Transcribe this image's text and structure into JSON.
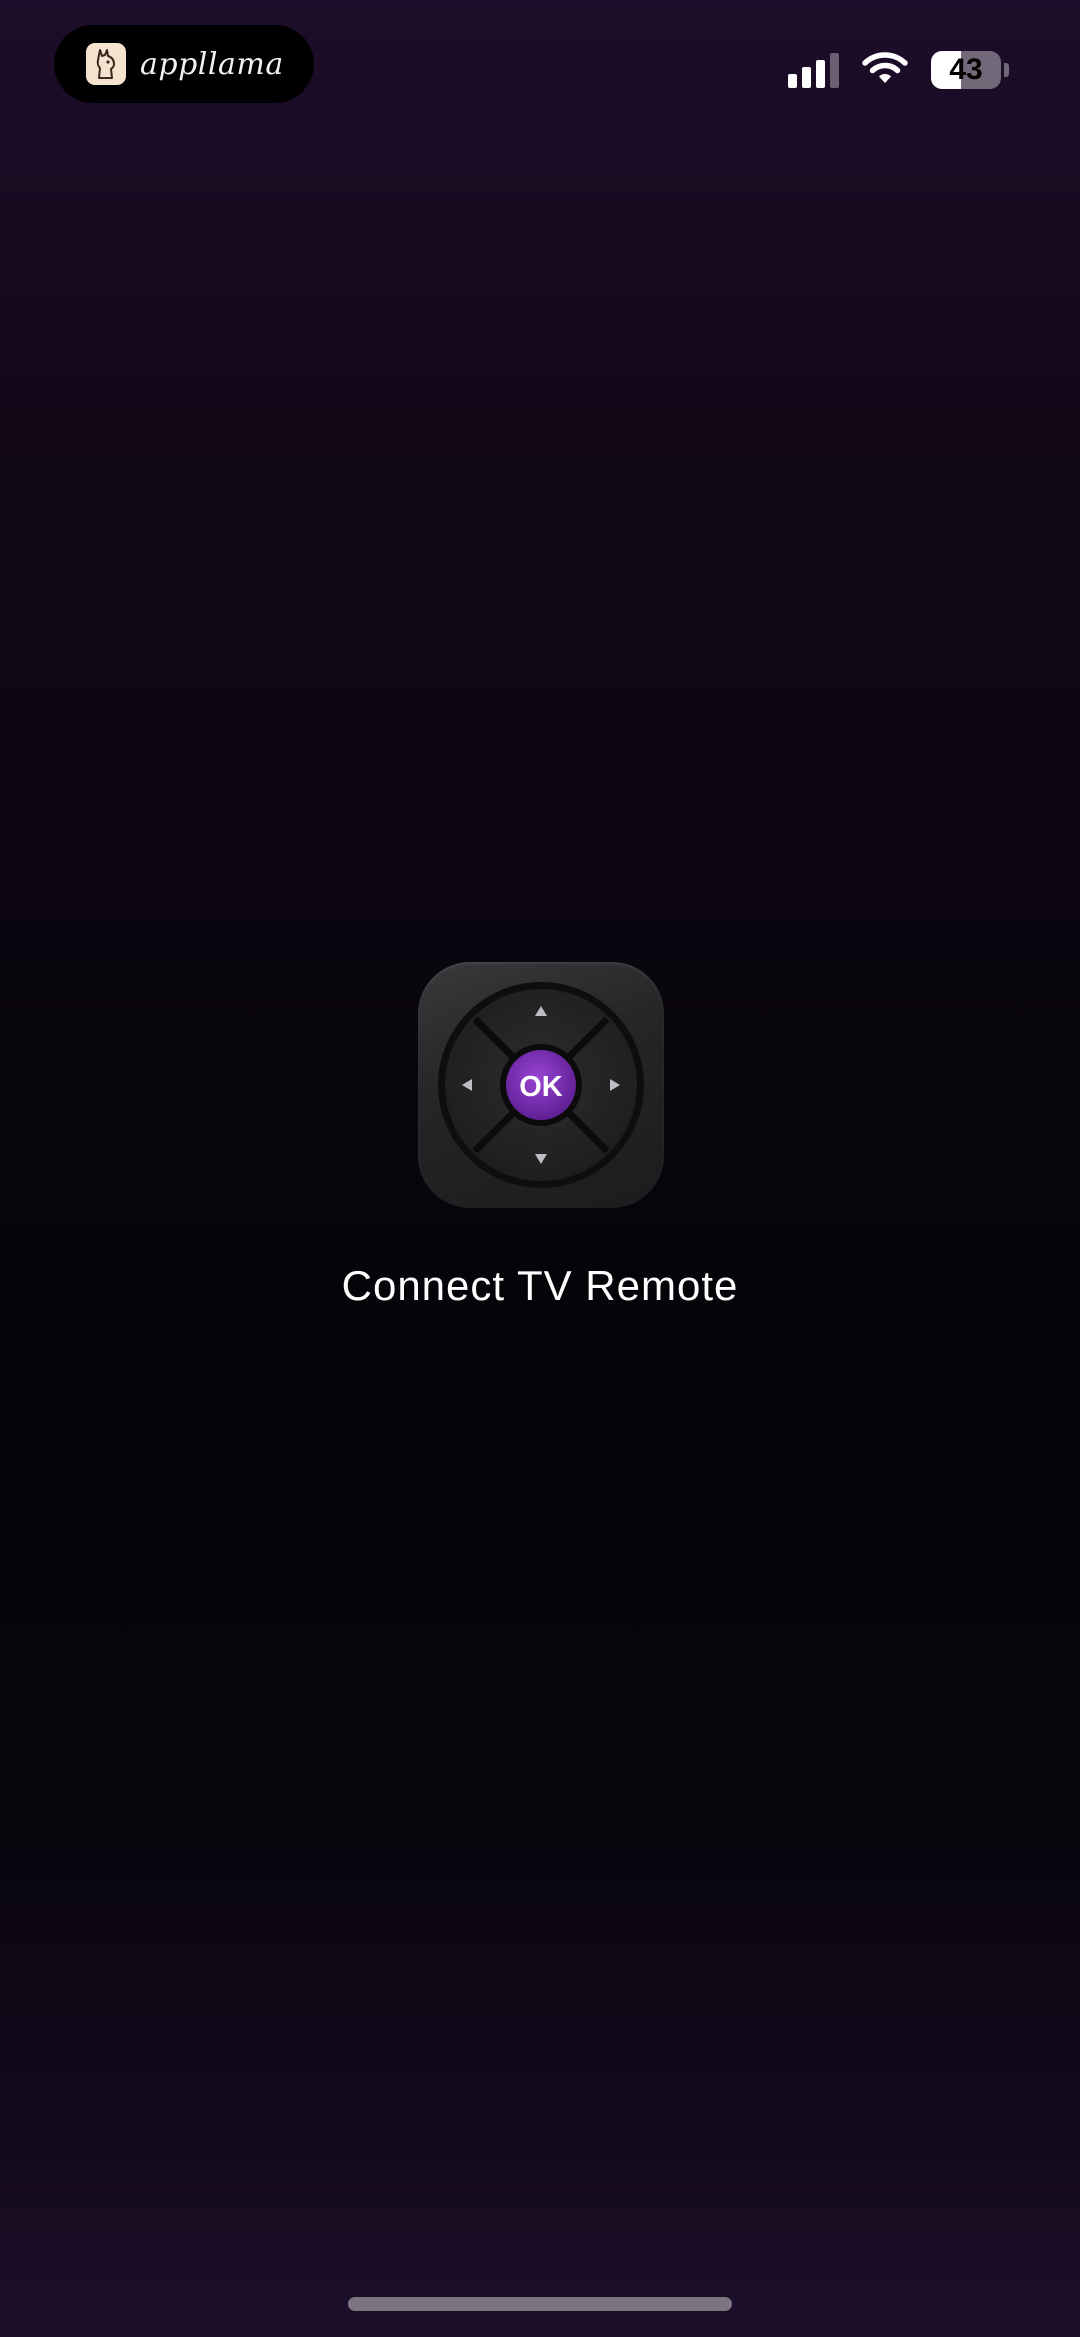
{
  "status_bar": {
    "badge_text": "appllama",
    "logo_icon": "llama-logo-icon",
    "signal_icon": "cellular-signal-icon",
    "signal_bars_active": 3,
    "signal_bars_total": 4,
    "wifi_icon": "wifi-icon",
    "battery_icon": "battery-icon",
    "battery_percent": "43",
    "battery_level": 0.43
  },
  "splash": {
    "app_icon": "tv-remote-dpad-icon",
    "ok_label": "OK",
    "title": "Connect TV Remote",
    "accent_color": "#7a2bb5"
  },
  "colors": {
    "background_top": "#1d0d2a",
    "background_middle": "#06040a",
    "background_bottom": "#1d0f2a"
  }
}
